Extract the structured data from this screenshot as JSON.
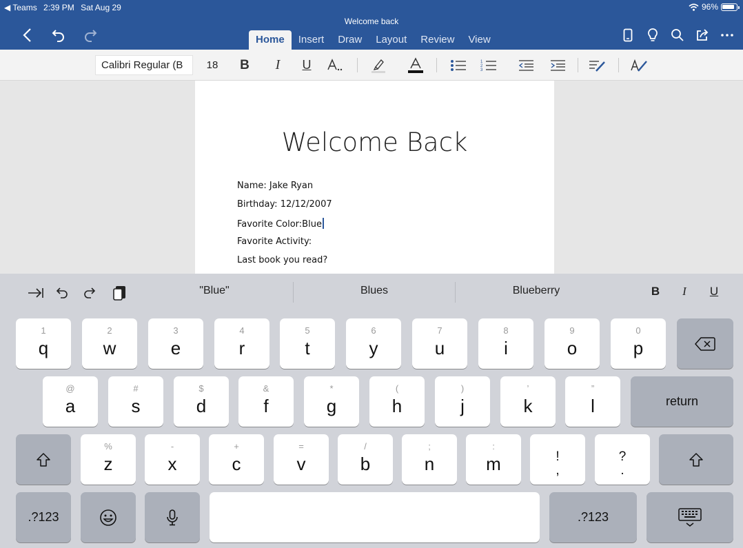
{
  "status": {
    "back_app": "◀ Teams",
    "time": "2:39 PM",
    "date": "Sat Aug 29",
    "battery_text": "96%",
    "battery_level": 0.96
  },
  "doc_title": "Welcome back",
  "tabs": [
    "Home",
    "Insert",
    "Draw",
    "Layout",
    "Review",
    "View"
  ],
  "ribbon": {
    "font_name": "Calibri Regular (B",
    "font_size": "18",
    "bold": "B",
    "italic": "I",
    "underline": "U",
    "highlight_letter": "A",
    "font_color_letter": "A"
  },
  "document": {
    "heading": "Welcome Back",
    "lines": [
      "Name:  Jake Ryan",
      "Birthday: 12/12/2007",
      "Favorite Color:Blue",
      "Favorite Activity:",
      "Last book you read?"
    ]
  },
  "keyboard": {
    "suggestions": [
      "\"Blue\"",
      "Blues",
      "Blueberry"
    ],
    "format": {
      "bold": "B",
      "italic": "I",
      "underline": "U"
    },
    "row1": [
      {
        "k": "q",
        "a": "1"
      },
      {
        "k": "w",
        "a": "2"
      },
      {
        "k": "e",
        "a": "3"
      },
      {
        "k": "r",
        "a": "4"
      },
      {
        "k": "t",
        "a": "5"
      },
      {
        "k": "y",
        "a": "6"
      },
      {
        "k": "u",
        "a": "7"
      },
      {
        "k": "i",
        "a": "8"
      },
      {
        "k": "o",
        "a": "9"
      },
      {
        "k": "p",
        "a": "0"
      }
    ],
    "row2": [
      {
        "k": "a",
        "a": "@"
      },
      {
        "k": "s",
        "a": "#"
      },
      {
        "k": "d",
        "a": "$"
      },
      {
        "k": "f",
        "a": "&"
      },
      {
        "k": "g",
        "a": "*"
      },
      {
        "k": "h",
        "a": "("
      },
      {
        "k": "j",
        "a": ")"
      },
      {
        "k": "k",
        "a": "’"
      },
      {
        "k": "l",
        "a": "”"
      }
    ],
    "row3": [
      {
        "k": "z",
        "a": "%"
      },
      {
        "k": "x",
        "a": "-"
      },
      {
        "k": "c",
        "a": "+"
      },
      {
        "k": "v",
        "a": "="
      },
      {
        "k": "b",
        "a": "/"
      },
      {
        "k": "n",
        "a": ";"
      },
      {
        "k": "m",
        "a": ":"
      },
      {
        "k": "!\n,",
        "a": ""
      },
      {
        "k": "?\n.",
        "a": ""
      }
    ],
    "return_label": "return",
    "numbers_label": ".?123"
  }
}
